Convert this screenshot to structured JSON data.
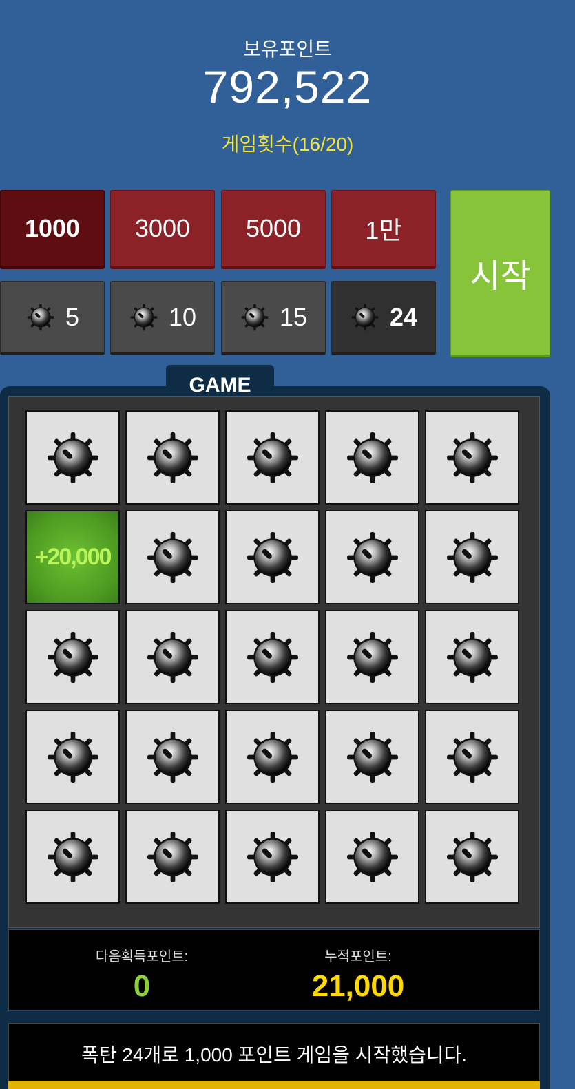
{
  "header": {
    "points_label": "보유포인트",
    "points_value": "792,522",
    "game_count": "게임횟수(16/20)"
  },
  "bets": [
    {
      "label": "1000",
      "selected": true
    },
    {
      "label": "3000",
      "selected": false
    },
    {
      "label": "5000",
      "selected": false
    },
    {
      "label": "1만",
      "selected": false
    }
  ],
  "bomb_options": [
    {
      "label": "5",
      "icon": "bomb-icon",
      "selected": false
    },
    {
      "label": "10",
      "icon": "bomb-icon",
      "selected": false
    },
    {
      "label": "15",
      "icon": "bomb-icon",
      "selected": false
    },
    {
      "label": "24",
      "icon": "bomb-icon",
      "selected": true
    }
  ],
  "start_label": "시작",
  "game_tab_label": "GAME",
  "board": {
    "rows": 5,
    "cols": 5,
    "cells": [
      "bomb",
      "bomb",
      "bomb",
      "bomb",
      "bomb",
      "+20,000",
      "bomb",
      "bomb",
      "bomb",
      "bomb",
      "bomb",
      "bomb",
      "bomb",
      "bomb",
      "bomb",
      "bomb",
      "bomb",
      "bomb",
      "bomb",
      "bomb",
      "bomb",
      "bomb",
      "bomb",
      "bomb",
      "bomb"
    ]
  },
  "score": {
    "next_label": "다음획득포인트:",
    "next_value": "0",
    "total_label": "누적포인트:",
    "total_value": "21,000"
  },
  "message": "폭탄 24개로 1,000 포인트 게임을 시작했습니다.",
  "colors": {
    "background": "#315f98",
    "next_value": "#8bd13c",
    "total_value": "#ffd800",
    "game_count": "#f4e535"
  }
}
